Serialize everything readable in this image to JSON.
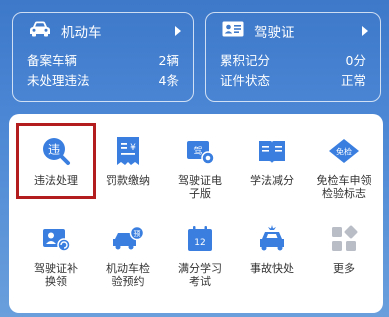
{
  "vehicle_card": {
    "title": "机动车",
    "rows": [
      {
        "label": "备案车辆",
        "value": "2辆"
      },
      {
        "label": "未处理违法",
        "value": "4条"
      }
    ]
  },
  "license_card": {
    "title": "驾驶证",
    "rows": [
      {
        "label": "累积记分",
        "value": "0分"
      },
      {
        "label": "证件状态",
        "value": "正常"
      }
    ]
  },
  "services": [
    {
      "label": "违法处理",
      "icon": "violation-search-icon"
    },
    {
      "label": "罚款缴纳",
      "icon": "fine-payment-icon"
    },
    {
      "label": "驾驶证电子版",
      "icon": "e-license-icon"
    },
    {
      "label": "学法减分",
      "icon": "study-book-icon"
    },
    {
      "label": "免检车申领检验标志",
      "icon": "exempt-inspection-icon"
    },
    {
      "label": "驾驶证补换领",
      "icon": "license-replace-icon"
    },
    {
      "label": "机动车检验预约",
      "icon": "vehicle-inspection-booking-icon"
    },
    {
      "label": "满分学习考试",
      "icon": "full-score-exam-icon"
    },
    {
      "label": "事故快处",
      "icon": "accident-quick-icon"
    },
    {
      "label": "更多",
      "icon": "more-grid-icon"
    }
  ],
  "labels_display": {
    "s2": "驾驶证电\n子版",
    "s4": "免检车申领\n检验标志",
    "s5": "驾驶证补\n换领",
    "s6": "机动车检\n验预约",
    "s7": "满分学习\n考试"
  },
  "colors": {
    "primary": "#3d78c9",
    "icon_blue": "#3a7fe0",
    "highlight": "#b31d1d",
    "icon_gray": "#b9bec6"
  }
}
